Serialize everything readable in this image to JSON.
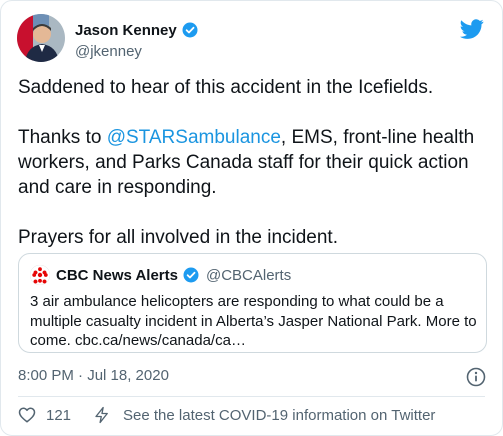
{
  "author": {
    "name": "Jason Kenney",
    "handle": "@jkenney"
  },
  "tweet": {
    "line1": "Saddened to hear of this accident in the Icefields.",
    "line2_prefix": "Thanks to ",
    "line2_mention": "@STARSambulance",
    "line2_suffix": ", EMS, front-line health workers, and Parks Canada staff for their quick action and care in responding.",
    "line3": "Prayers for all involved in the incident."
  },
  "quoted_tweet": {
    "name": "CBC News Alerts",
    "handle": "@CBCAlerts",
    "text": "3 air ambulance helicopters are responding to what could be a multiple casualty incident in Alberta’s Jasper National Park. More to come. cbc.ca/news/canada/ca…"
  },
  "meta": {
    "timestamp": "8:00 PM · Jul 18, 2020"
  },
  "actions": {
    "like_count": "121",
    "covid_link": "See the latest COVID-19 information on Twitter"
  },
  "colors": {
    "brand_blue": "#1d9bf0",
    "mention_blue": "#1b95e0",
    "cbc_red": "#e60505",
    "text": "#0f1419",
    "muted": "#536471"
  },
  "icons": [
    "verified-badge-icon",
    "twitter-bird-icon",
    "cbc-gem-icon",
    "info-icon",
    "heart-icon",
    "lightning-icon"
  ]
}
